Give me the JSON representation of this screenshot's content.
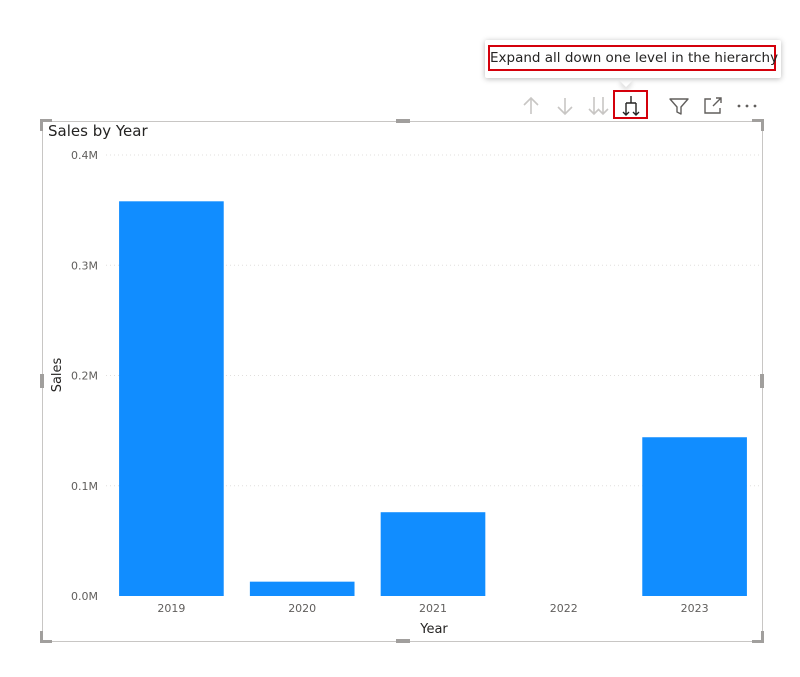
{
  "tooltip": {
    "text": "Expand all down one level in the hierarchy"
  },
  "toolbar": {
    "icons": [
      "drill-up-icon",
      "drill-down-icon",
      "go-to-next-level-icon",
      "expand-all-down-icon",
      "filter-icon",
      "focus-mode-icon",
      "more-options-icon"
    ],
    "active_color": "#252423",
    "inactive_color": "#c8c6c4",
    "highlight_color": "#d4000b"
  },
  "chart_data": {
    "type": "bar",
    "title": "Sales by Year",
    "xlabel": "Year",
    "ylabel": "Sales",
    "categories": [
      "2019",
      "2020",
      "2021",
      "2022",
      "2023"
    ],
    "values": [
      0.358,
      0.013,
      0.076,
      0,
      0.144
    ],
    "value_unit": "M",
    "ylim": [
      0,
      0.4
    ],
    "yticks": [
      "0.0M",
      "0.1M",
      "0.2M",
      "0.3M",
      "0.4M"
    ],
    "grid": true,
    "bar_color": "#118dff"
  }
}
